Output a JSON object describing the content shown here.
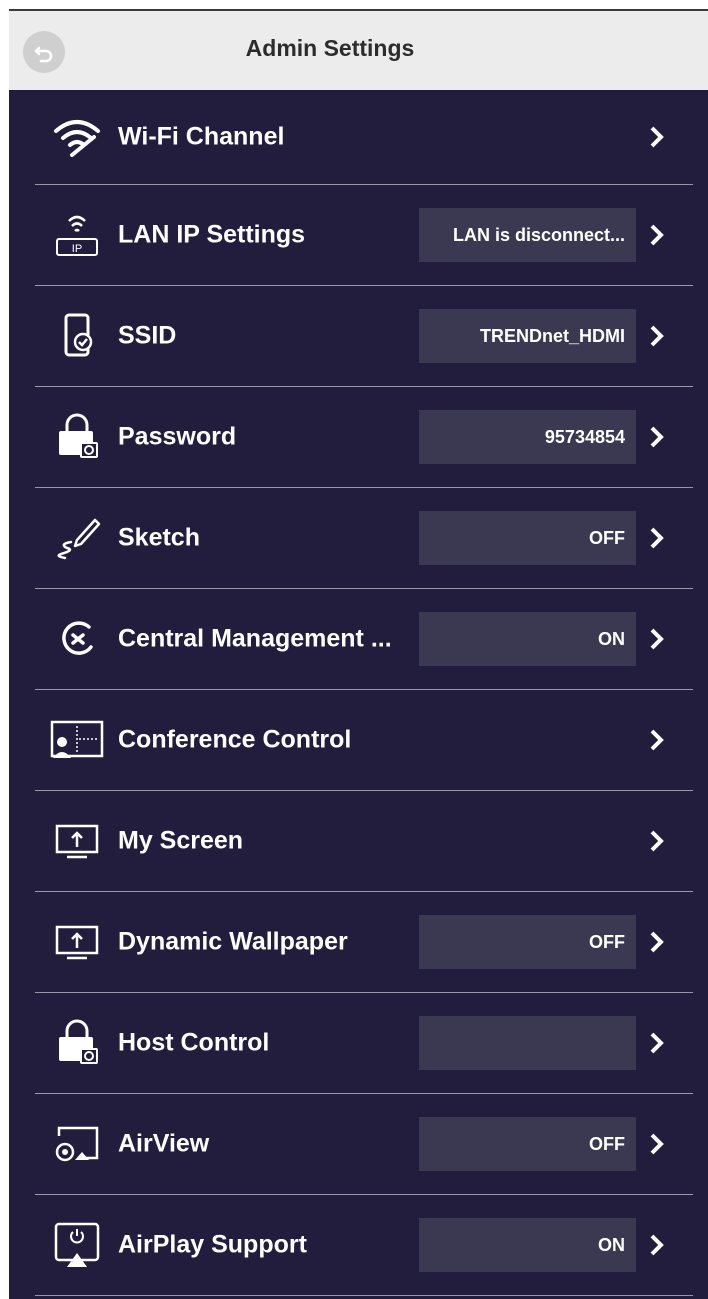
{
  "header": {
    "title": "Admin Settings"
  },
  "rows": [
    {
      "icon": "wifi-icon",
      "label": "Wi-Fi Channel",
      "value": null
    },
    {
      "icon": "lan-ip-icon",
      "label": "LAN IP Settings",
      "value": "LAN is disconnect...",
      "icon_text": "IP"
    },
    {
      "icon": "device-check-icon",
      "label": "SSID",
      "value": "TRENDnet_HDMI"
    },
    {
      "icon": "lock-screen-icon",
      "label": "Password",
      "value": "95734854"
    },
    {
      "icon": "pencil-sketch-icon",
      "label": "Sketch",
      "value": "OFF"
    },
    {
      "icon": "central-management-icon",
      "label": "Central Management ...",
      "value": "ON"
    },
    {
      "icon": "conference-icon",
      "label": "Conference Control",
      "value": null
    },
    {
      "icon": "screen-upload-icon",
      "label": "My Screen",
      "value": null
    },
    {
      "icon": "screen-upload-icon",
      "label": "Dynamic Wallpaper",
      "value": "OFF"
    },
    {
      "icon": "lock-screen-icon",
      "label": "Host Control",
      "value": ""
    },
    {
      "icon": "airview-icon",
      "label": "AirView",
      "value": "OFF"
    },
    {
      "icon": "airplay-icon",
      "label": "AirPlay Support",
      "value": "ON"
    }
  ]
}
